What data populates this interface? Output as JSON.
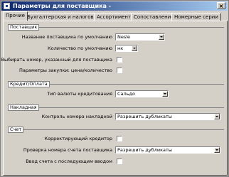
{
  "window": {
    "title": "Параметры для поставщика -"
  },
  "tabs": [
    {
      "label": "Прочие",
      "active": true
    },
    {
      "label": "Бухгалтерская и налоговая",
      "active": false
    },
    {
      "label": "Ассортимента",
      "active": false
    },
    {
      "label": "Сопоставление",
      "active": false
    },
    {
      "label": "Номерные серии",
      "active": false
    }
  ],
  "sections": {
    "postavka": {
      "title": "Поставщик",
      "rows": [
        {
          "label": "Название поставщика по умолчанию",
          "value": "Nesle"
        },
        {
          "label": "Количество по умолчанию",
          "value": "нк"
        },
        {
          "label": "Выбирать номер, указанный для поставщика",
          "checked": false
        },
        {
          "label": "Параметры закупки: цена/количество",
          "checked": false
        }
      ]
    },
    "credit": {
      "title": "Кредит/Оплата",
      "rows": [
        {
          "label": "Тип валюты кредитования",
          "value": "Сальдо"
        }
      ]
    },
    "numbering": {
      "title": "Накладная",
      "rows": [
        {
          "label": "Контроль номера накладной",
          "value": "Разрешить дубликаты"
        }
      ]
    },
    "other": {
      "title": "Счет",
      "rows": [
        {
          "label": "Корректирующий кредитор",
          "checked": false
        },
        {
          "label": "Проверка номера счета поставщика",
          "value": "Разрешить дубликаты"
        },
        {
          "label": "Ввод счета с последующим вводом",
          "checked": false
        }
      ]
    }
  }
}
